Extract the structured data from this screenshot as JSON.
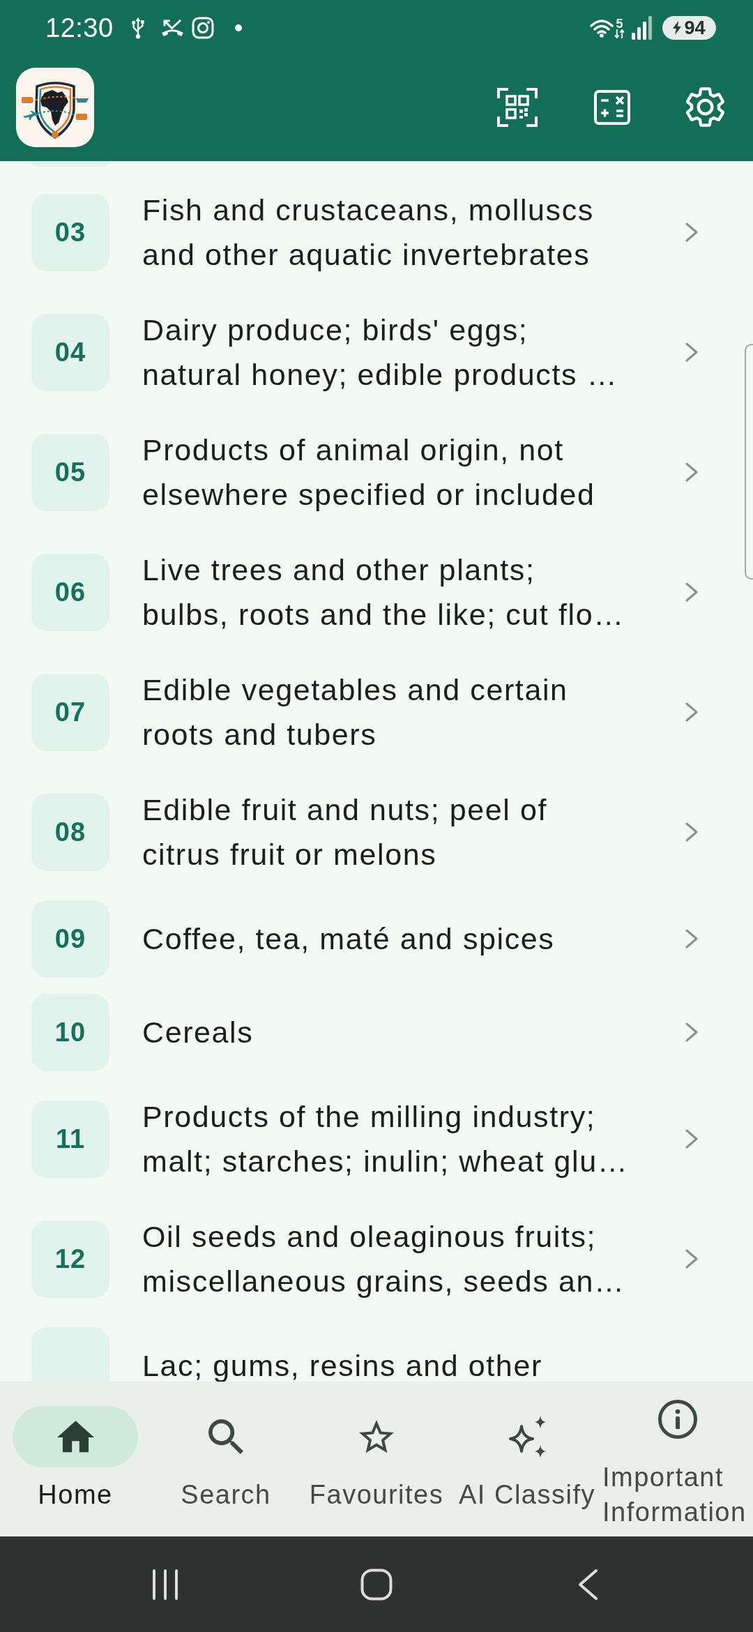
{
  "status_bar": {
    "time": "12:30",
    "wifi_band": "5",
    "battery": {
      "percent": "94",
      "charging": true
    }
  },
  "chapters": [
    {
      "code": "03",
      "title": "Fish and crustaceans, molluscs\nand other aquatic invertebrates"
    },
    {
      "code": "04",
      "title": "Dairy produce; birds' eggs;\nnatural honey; edible products …"
    },
    {
      "code": "05",
      "title": "Products of animal origin, not\nelsewhere specified or included"
    },
    {
      "code": "06",
      "title": "Live trees and other plants;\nbulbs, roots and the like; cut flo…"
    },
    {
      "code": "07",
      "title": "Edible vegetables and certain\nroots and tubers"
    },
    {
      "code": "08",
      "title": "Edible fruit and nuts; peel of\ncitrus fruit or melons"
    },
    {
      "code": "09",
      "title": "Coffee, tea, maté and spices"
    },
    {
      "code": "10",
      "title": "Cereals"
    },
    {
      "code": "11",
      "title": "Products of the milling industry;\nmalt; starches; inulin; wheat glu…"
    },
    {
      "code": "12",
      "title": "Oil seeds and oleaginous fruits;\nmiscellaneous grains, seeds an…"
    },
    {
      "title": "Lac; gums, resins and other"
    }
  ],
  "bottom_nav": [
    {
      "label": "Home",
      "selected": true
    },
    {
      "label": "Search",
      "selected": false
    },
    {
      "label": "Favourites",
      "selected": false
    },
    {
      "label": "AI Classify",
      "selected": false
    },
    {
      "label": "Important Information",
      "selected": false
    }
  ]
}
